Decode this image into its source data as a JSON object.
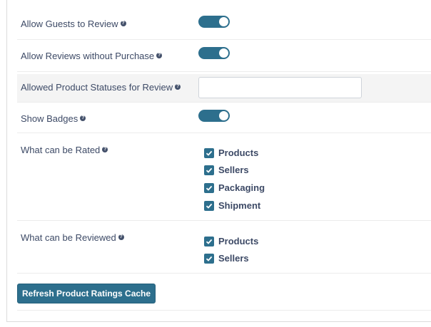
{
  "settings": {
    "allow_guests": {
      "label": "Allow Guests to Review",
      "enabled": true
    },
    "allow_without_purchase": {
      "label": "Allow Reviews without Purchase",
      "enabled": true
    },
    "allowed_statuses": {
      "label": "Allowed Product Statuses for Review",
      "value": ""
    },
    "show_badges": {
      "label": "Show Badges",
      "enabled": true
    },
    "rated": {
      "label": "What can be Rated",
      "options": [
        {
          "label": "Products",
          "checked": true
        },
        {
          "label": "Sellers",
          "checked": true
        },
        {
          "label": "Packaging",
          "checked": true
        },
        {
          "label": "Shipment",
          "checked": true
        }
      ]
    },
    "reviewed": {
      "label": "What can be Reviewed",
      "options": [
        {
          "label": "Products",
          "checked": true
        },
        {
          "label": "Sellers",
          "checked": true
        }
      ]
    }
  },
  "help_icon_glyph": "?",
  "refresh_button_label": "Refresh Product Ratings Cache",
  "colors": {
    "accent": "#2d6f8d",
    "text": "#3d4a66",
    "row_shade": "#f4f4f4"
  }
}
